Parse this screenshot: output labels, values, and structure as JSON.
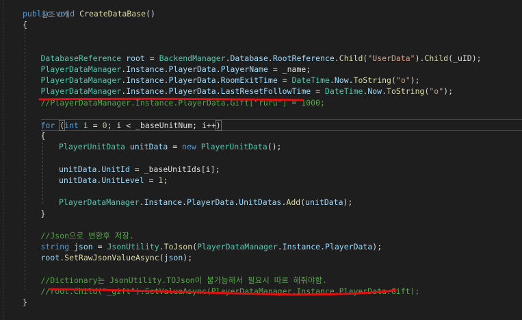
{
  "code_lens": "참조 0개",
  "lines": [
    {
      "indent": 0,
      "tokens": [
        {
          "t": "kw",
          "v": "public"
        },
        {
          "t": "plain",
          "v": " "
        },
        {
          "t": "kw",
          "v": "void"
        },
        {
          "t": "plain",
          "v": " "
        },
        {
          "t": "fn",
          "v": "CreateDataBase"
        },
        {
          "t": "plain",
          "v": "()"
        }
      ]
    },
    {
      "indent": 0,
      "tokens": [
        {
          "t": "plain",
          "v": "{"
        }
      ]
    },
    {
      "indent": 0,
      "tokens": []
    },
    {
      "indent": 0,
      "tokens": []
    },
    {
      "indent": 1,
      "tokens": [
        {
          "t": "type",
          "v": "DatabaseReference"
        },
        {
          "t": "plain",
          "v": " "
        },
        {
          "t": "var",
          "v": "root"
        },
        {
          "t": "plain",
          "v": " = "
        },
        {
          "t": "type",
          "v": "BackendManager"
        },
        {
          "t": "plain",
          "v": "."
        },
        {
          "t": "var",
          "v": "Database"
        },
        {
          "t": "plain",
          "v": "."
        },
        {
          "t": "var",
          "v": "RootReference"
        },
        {
          "t": "plain",
          "v": "."
        },
        {
          "t": "fn",
          "v": "Child"
        },
        {
          "t": "plain",
          "v": "("
        },
        {
          "t": "str",
          "v": "\"UserData\""
        },
        {
          "t": "plain",
          "v": ")."
        },
        {
          "t": "fn",
          "v": "Child"
        },
        {
          "t": "plain",
          "v": "(_uID);"
        }
      ]
    },
    {
      "indent": 1,
      "tokens": [
        {
          "t": "type",
          "v": "PlayerDataManager"
        },
        {
          "t": "plain",
          "v": "."
        },
        {
          "t": "var",
          "v": "Instance"
        },
        {
          "t": "plain",
          "v": "."
        },
        {
          "t": "var",
          "v": "PlayerData"
        },
        {
          "t": "plain",
          "v": "."
        },
        {
          "t": "var",
          "v": "PlayerName"
        },
        {
          "t": "plain",
          "v": " = _name;"
        }
      ]
    },
    {
      "indent": 1,
      "tokens": [
        {
          "t": "type",
          "v": "PlayerDataManager"
        },
        {
          "t": "plain",
          "v": "."
        },
        {
          "t": "var",
          "v": "Instance"
        },
        {
          "t": "plain",
          "v": "."
        },
        {
          "t": "var",
          "v": "PlayerData"
        },
        {
          "t": "plain",
          "v": "."
        },
        {
          "t": "var",
          "v": "RoomExitTime"
        },
        {
          "t": "plain",
          "v": " = "
        },
        {
          "t": "type",
          "v": "DateTime"
        },
        {
          "t": "plain",
          "v": "."
        },
        {
          "t": "var",
          "v": "Now"
        },
        {
          "t": "plain",
          "v": "."
        },
        {
          "t": "fn",
          "v": "ToString"
        },
        {
          "t": "plain",
          "v": "("
        },
        {
          "t": "str",
          "v": "\"o\""
        },
        {
          "t": "plain",
          "v": ");"
        }
      ]
    },
    {
      "indent": 1,
      "tokens": [
        {
          "t": "type",
          "v": "PlayerDataManager"
        },
        {
          "t": "plain",
          "v": "."
        },
        {
          "t": "var",
          "v": "Instance"
        },
        {
          "t": "plain",
          "v": "."
        },
        {
          "t": "var",
          "v": "PlayerData"
        },
        {
          "t": "plain",
          "v": "."
        },
        {
          "t": "var",
          "v": "LastResetFollowTime"
        },
        {
          "t": "plain",
          "v": " = "
        },
        {
          "t": "type",
          "v": "DateTime"
        },
        {
          "t": "plain",
          "v": "."
        },
        {
          "t": "var",
          "v": "Now"
        },
        {
          "t": "plain",
          "v": "."
        },
        {
          "t": "fn",
          "v": "ToString"
        },
        {
          "t": "plain",
          "v": "("
        },
        {
          "t": "str",
          "v": "\"o\""
        },
        {
          "t": "plain",
          "v": ");"
        }
      ]
    },
    {
      "indent": 1,
      "tokens": [
        {
          "t": "cmt",
          "v": "//PlayerDataManager.Instance.PlayerData.Gift[\"ruru\"] = 1000;"
        }
      ]
    },
    {
      "indent": 0,
      "tokens": []
    },
    {
      "indent": 1,
      "current": true,
      "tokens": [
        {
          "t": "kw",
          "v": "for"
        },
        {
          "t": "plain",
          "v": " "
        },
        {
          "t": "bracket",
          "v": "("
        },
        {
          "t": "kw",
          "v": "int"
        },
        {
          "t": "plain",
          "v": " "
        },
        {
          "t": "var",
          "v": "i"
        },
        {
          "t": "plain",
          "v": " = "
        },
        {
          "t": "num",
          "v": "0"
        },
        {
          "t": "plain",
          "v": "; i < _baseUnitNum; i++"
        },
        {
          "t": "bracket",
          "v": ")"
        }
      ]
    },
    {
      "indent": 1,
      "tokens": [
        {
          "t": "plain",
          "v": "{"
        }
      ]
    },
    {
      "indent": 2,
      "tokens": [
        {
          "t": "type",
          "v": "PlayerUnitData"
        },
        {
          "t": "plain",
          "v": " "
        },
        {
          "t": "var",
          "v": "unitData"
        },
        {
          "t": "plain",
          "v": " = "
        },
        {
          "t": "kw",
          "v": "new"
        },
        {
          "t": "plain",
          "v": " "
        },
        {
          "t": "type",
          "v": "PlayerUnitData"
        },
        {
          "t": "plain",
          "v": "();"
        }
      ]
    },
    {
      "indent": 0,
      "tokens": []
    },
    {
      "indent": 2,
      "tokens": [
        {
          "t": "var",
          "v": "unitData"
        },
        {
          "t": "plain",
          "v": "."
        },
        {
          "t": "var",
          "v": "UnitId"
        },
        {
          "t": "plain",
          "v": " = _baseUnitIds[i];"
        }
      ]
    },
    {
      "indent": 2,
      "tokens": [
        {
          "t": "var",
          "v": "unitData"
        },
        {
          "t": "plain",
          "v": "."
        },
        {
          "t": "var",
          "v": "UnitLevel"
        },
        {
          "t": "plain",
          "v": " = "
        },
        {
          "t": "num",
          "v": "1"
        },
        {
          "t": "plain",
          "v": ";"
        }
      ]
    },
    {
      "indent": 0,
      "tokens": []
    },
    {
      "indent": 2,
      "tokens": [
        {
          "t": "type",
          "v": "PlayerDataManager"
        },
        {
          "t": "plain",
          "v": "."
        },
        {
          "t": "var",
          "v": "Instance"
        },
        {
          "t": "plain",
          "v": "."
        },
        {
          "t": "var",
          "v": "PlayerData"
        },
        {
          "t": "plain",
          "v": "."
        },
        {
          "t": "var",
          "v": "UnitDatas"
        },
        {
          "t": "plain",
          "v": "."
        },
        {
          "t": "fn",
          "v": "Add"
        },
        {
          "t": "plain",
          "v": "("
        },
        {
          "t": "var",
          "v": "unitData"
        },
        {
          "t": "plain",
          "v": ");"
        }
      ]
    },
    {
      "indent": 1,
      "tokens": [
        {
          "t": "plain",
          "v": "}"
        }
      ]
    },
    {
      "indent": 0,
      "tokens": []
    },
    {
      "indent": 1,
      "tokens": [
        {
          "t": "cmt",
          "v": "//Json으로 변환후 저장."
        }
      ]
    },
    {
      "indent": 1,
      "tokens": [
        {
          "t": "kw",
          "v": "string"
        },
        {
          "t": "plain",
          "v": " "
        },
        {
          "t": "var",
          "v": "json"
        },
        {
          "t": "plain",
          "v": " = "
        },
        {
          "t": "type",
          "v": "JsonUtility"
        },
        {
          "t": "plain",
          "v": "."
        },
        {
          "t": "fn",
          "v": "ToJson"
        },
        {
          "t": "plain",
          "v": "("
        },
        {
          "t": "type",
          "v": "PlayerDataManager"
        },
        {
          "t": "plain",
          "v": "."
        },
        {
          "t": "var",
          "v": "Instance"
        },
        {
          "t": "plain",
          "v": "."
        },
        {
          "t": "var",
          "v": "PlayerData"
        },
        {
          "t": "plain",
          "v": ");"
        }
      ]
    },
    {
      "indent": 1,
      "tokens": [
        {
          "t": "var",
          "v": "root"
        },
        {
          "t": "plain",
          "v": "."
        },
        {
          "t": "fn",
          "v": "SetRawJsonValueAsync"
        },
        {
          "t": "plain",
          "v": "("
        },
        {
          "t": "var",
          "v": "json"
        },
        {
          "t": "plain",
          "v": ");"
        }
      ]
    },
    {
      "indent": 0,
      "tokens": []
    },
    {
      "indent": 1,
      "tokens": [
        {
          "t": "cmt",
          "v": "//Dictionary는 JsonUtility.TOJson이 불가능해서 필요시 따로 해줘야함."
        }
      ]
    },
    {
      "indent": 1,
      "tokens": [
        {
          "t": "cmt",
          "v": "//root.Child(\"_gift\").SetValueAsync(PlayerDataManager.Instance.PlayerData.Gift);"
        }
      ]
    },
    {
      "indent": 0,
      "tokens": [
        {
          "t": "plain",
          "v": "}"
        }
      ]
    }
  ],
  "colors": {
    "background": "#1e1e1e",
    "keyword": "#569cd6",
    "type": "#4ec9b0",
    "method": "#dcdcaa",
    "string": "#d69d85",
    "number": "#b5cea8",
    "comment": "#57a64a",
    "variable": "#9cdcfe",
    "plain": "#dcdcdc",
    "annotation": "#e01010"
  }
}
